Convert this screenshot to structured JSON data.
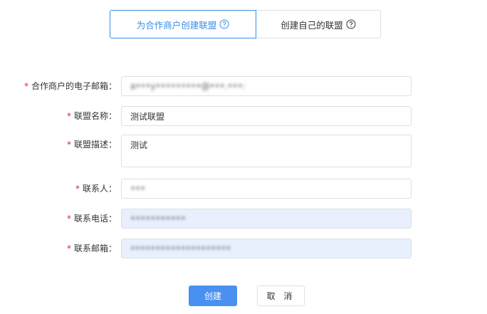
{
  "tabs": [
    {
      "label": "为合作商户创建联盟",
      "active": true,
      "icon": "help-circle-icon"
    },
    {
      "label": "创建自己的联盟",
      "active": false,
      "icon": "help-circle-icon"
    }
  ],
  "form": {
    "required_mark": "*",
    "fields": [
      {
        "label": "合作商户的电子邮箱：",
        "value": "a•••y•••••••••@•••.•••:"
      },
      {
        "label": "联盟名称：",
        "value": "测试联盟"
      },
      {
        "label": "联盟描述：",
        "value": "测试"
      },
      {
        "label": "联系人：",
        "value": "•••"
      },
      {
        "label": "联系电话：",
        "value": "•••••••••••"
      },
      {
        "label": "联系邮箱：",
        "value": "••••••••••••••••••••"
      }
    ]
  },
  "buttons": {
    "create_label": "创建",
    "cancel_label": "取 消"
  },
  "colors": {
    "accent": "#3a8ee6",
    "primary_button": "#4a90f0",
    "required": "#e0242b",
    "autofill_bg": "#e8f0fe"
  }
}
